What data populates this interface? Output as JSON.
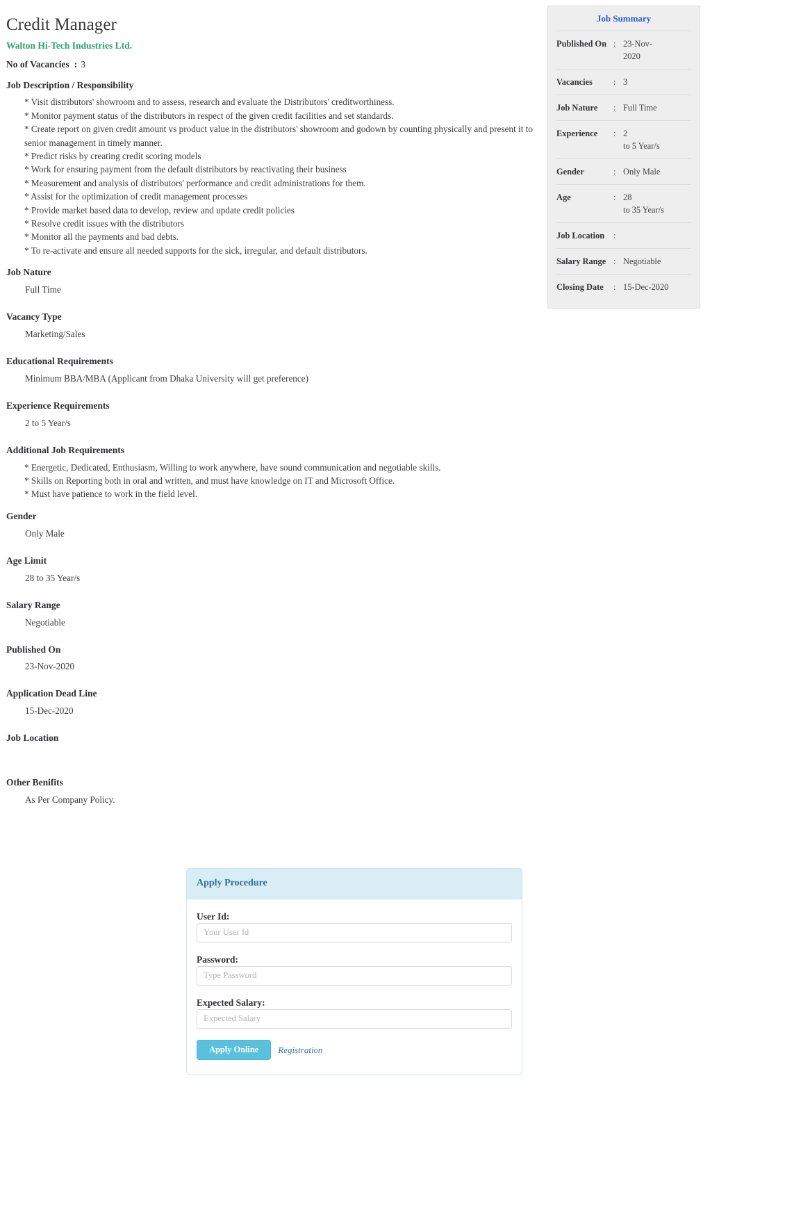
{
  "job": {
    "title": "Credit Manager",
    "company": "Walton Hi-Tech Industries Ltd.",
    "vacancies_label": "No of Vacancies",
    "vacancies_colon": ":",
    "vacancies_value": "3"
  },
  "sections": {
    "description_head": "Job Description / Responsibility",
    "description_bullets": [
      "* Visit distributors' showroom and to assess, research and evaluate the Distributors' creditworthiness.",
      "* Monitor payment status of the distributors in respect of the given credit facilities and set standards.",
      "* Create report on given credit amount vs product value in the distributors' showroom and godown by counting physically and present it to senior management in timely manner.",
      "* Predict risks by creating credit scoring models",
      "* Work for ensuring payment from the default distributors by reactivating their business",
      "* Measurement and analysis of distributors' performance and credit administrations for them.",
      "* Assist for the optimization of credit management processes",
      "* Provide market based data to develop, review and update credit policies",
      "* Resolve credit issues with the distributors",
      "* Monitor all the payments and bad debts.",
      "* To re-activate and ensure all needed supports for the sick, irregular, and default distributors."
    ],
    "job_nature_head": "Job Nature",
    "job_nature_value": "Full Time",
    "vacancy_type_head": "Vacancy Type",
    "vacancy_type_value": "Marketing/Sales",
    "educational_head": "Educational Requirements",
    "educational_value": "Minimum BBA/MBA (Applicant from Dhaka University will get preference)",
    "experience_head": "Experience Requirements",
    "experience_value": "2 to 5  Year/s",
    "additional_head": "Additional Job Requirements",
    "additional_bullets": [
      "* Energetic, Dedicated, Enthusiasm, Willing to work anywhere, have sound communication and negotiable skills.",
      "* Skills on Reporting both in oral and written, and must have knowledge on IT and Microsoft Office.",
      "* Must have patience to work in the field level."
    ],
    "gender_head": "Gender",
    "gender_value": "Only Male",
    "age_head": "Age Limit",
    "age_value": "28 to 35  Year/s",
    "salary_head": "Salary Range",
    "salary_value": "Negotiable",
    "published_head": "Published On",
    "published_value": "23-Nov-2020",
    "deadline_head": "Application Dead Line",
    "deadline_value": "15-Dec-2020",
    "location_head": "Job Location",
    "location_value": "",
    "benefits_head": "Other Benifits",
    "benefits_value": "As Per Company Policy."
  },
  "summary": {
    "title": "Job Summary",
    "rows": [
      {
        "label": "Published On",
        "colon": ":",
        "value": "23-Nov-",
        "value2": "2020"
      },
      {
        "label": "Vacancies",
        "colon": ":",
        "value": "3",
        "value2": ""
      },
      {
        "label": "Job Nature",
        "colon": ":",
        "value": "Full Time",
        "value2": ""
      },
      {
        "label": "Experience",
        "colon": ":",
        "value": "2",
        "value2": "to 5  Year/s"
      },
      {
        "label": "Gender",
        "colon": ":",
        "value": "Only Male",
        "value2": ""
      },
      {
        "label": "Age",
        "colon": ":",
        "value": "28",
        "value2": "to 35  Year/s"
      },
      {
        "label": "Job Location",
        "colon": ":",
        "value": "",
        "value2": ""
      },
      {
        "label": "Salary Range",
        "colon": ":",
        "value": "Negotiable",
        "value2": ""
      },
      {
        "label": "Closing Date",
        "colon": ":",
        "value": "15-Dec-2020",
        "value2": ""
      }
    ]
  },
  "apply": {
    "header": "Apply Procedure",
    "user_id_label": "User Id:",
    "user_id_placeholder": "Your User Id",
    "user_id_value": "",
    "password_label": "Password:",
    "password_placeholder": "Type Password",
    "password_value": "",
    "expected_salary_label": "Expected Salary:",
    "expected_salary_placeholder": "Expected Salary",
    "expected_salary_value": "",
    "submit_label": "Apply Online",
    "registration_link": "Registration"
  },
  "colors": {
    "company_green": "#29a36a",
    "summary_title_blue": "#2a5bd7",
    "apply_head_bg": "#d9edf7",
    "apply_head_text": "#31708f",
    "apply_button_bg": "#5bc0de",
    "link_blue": "#3a6ea8"
  }
}
